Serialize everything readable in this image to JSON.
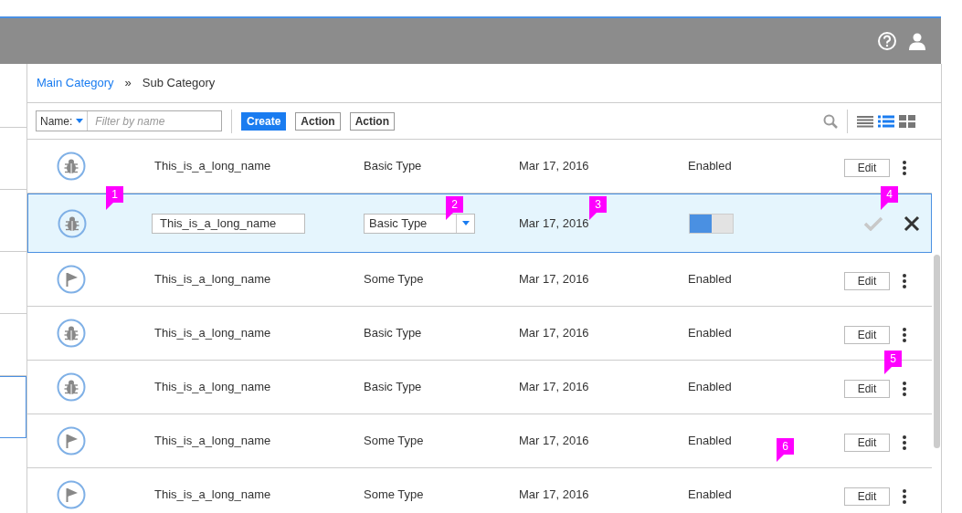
{
  "sidebar": {
    "items": [
      {
        "selected": false
      },
      {
        "selected": false
      },
      {
        "selected": false
      },
      {
        "selected": false
      },
      {
        "selected": true
      }
    ]
  },
  "breadcrumb": {
    "items": [
      {
        "label": "Main Category",
        "kind": "link"
      },
      {
        "label": "Sub Category",
        "kind": "current"
      }
    ],
    "separator": "»"
  },
  "toolbar": {
    "filter": {
      "label": "Name:",
      "placeholder": "Filter by name"
    },
    "buttons": [
      {
        "label": "Create",
        "primary": true
      },
      {
        "label": "Action",
        "primary": false
      },
      {
        "label": "Action",
        "primary": false
      }
    ],
    "views": [
      {
        "kind": "list",
        "selected": false
      },
      {
        "kind": "detail",
        "selected": true
      },
      {
        "kind": "grid",
        "selected": false
      }
    ]
  },
  "rows": [
    {
      "kind": "view",
      "icon": {
        "kind": "bug"
      },
      "name": "This_is_a_long_name",
      "type": "Basic Type",
      "date": "Mar 17, 2016",
      "status": "Enabled",
      "action": "Edit"
    },
    {
      "kind": "edit",
      "icon": {
        "kind": "bug"
      },
      "name": "This_is_a_long_name",
      "type": "Basic Type",
      "date": "Mar 17, 2016",
      "on": true,
      "save_enabled": false
    },
    {
      "kind": "view",
      "icon": {
        "kind": "flag"
      },
      "name": "This_is_a_long_name",
      "type": "Some Type",
      "date": "Mar 17, 2016",
      "status": "Enabled",
      "action": "Edit"
    },
    {
      "kind": "view",
      "icon": {
        "kind": "bug"
      },
      "name": "This_is_a_long_name",
      "type": "Basic Type",
      "date": "Mar 17, 2016",
      "status": "Enabled",
      "action": "Edit"
    },
    {
      "kind": "view",
      "icon": {
        "kind": "bug"
      },
      "name": "This_is_a_long_name",
      "type": "Basic Type",
      "date": "Mar 17, 2016",
      "status": "Enabled",
      "action": "Edit"
    },
    {
      "kind": "view",
      "icon": {
        "kind": "flag"
      },
      "name": "This_is_a_long_name",
      "type": "Some Type",
      "date": "Mar 17, 2016",
      "status": "Enabled",
      "action": "Edit"
    },
    {
      "kind": "view",
      "icon": {
        "kind": "flag"
      },
      "name": "This_is_a_long_name",
      "type": "Some Type",
      "date": "Mar 17, 2016",
      "status": "Enabled",
      "action": "Edit"
    }
  ],
  "callouts": [
    {
      "label": "1"
    },
    {
      "label": "2"
    },
    {
      "label": "3"
    },
    {
      "label": "4"
    },
    {
      "label": "5"
    },
    {
      "label": "6"
    }
  ]
}
